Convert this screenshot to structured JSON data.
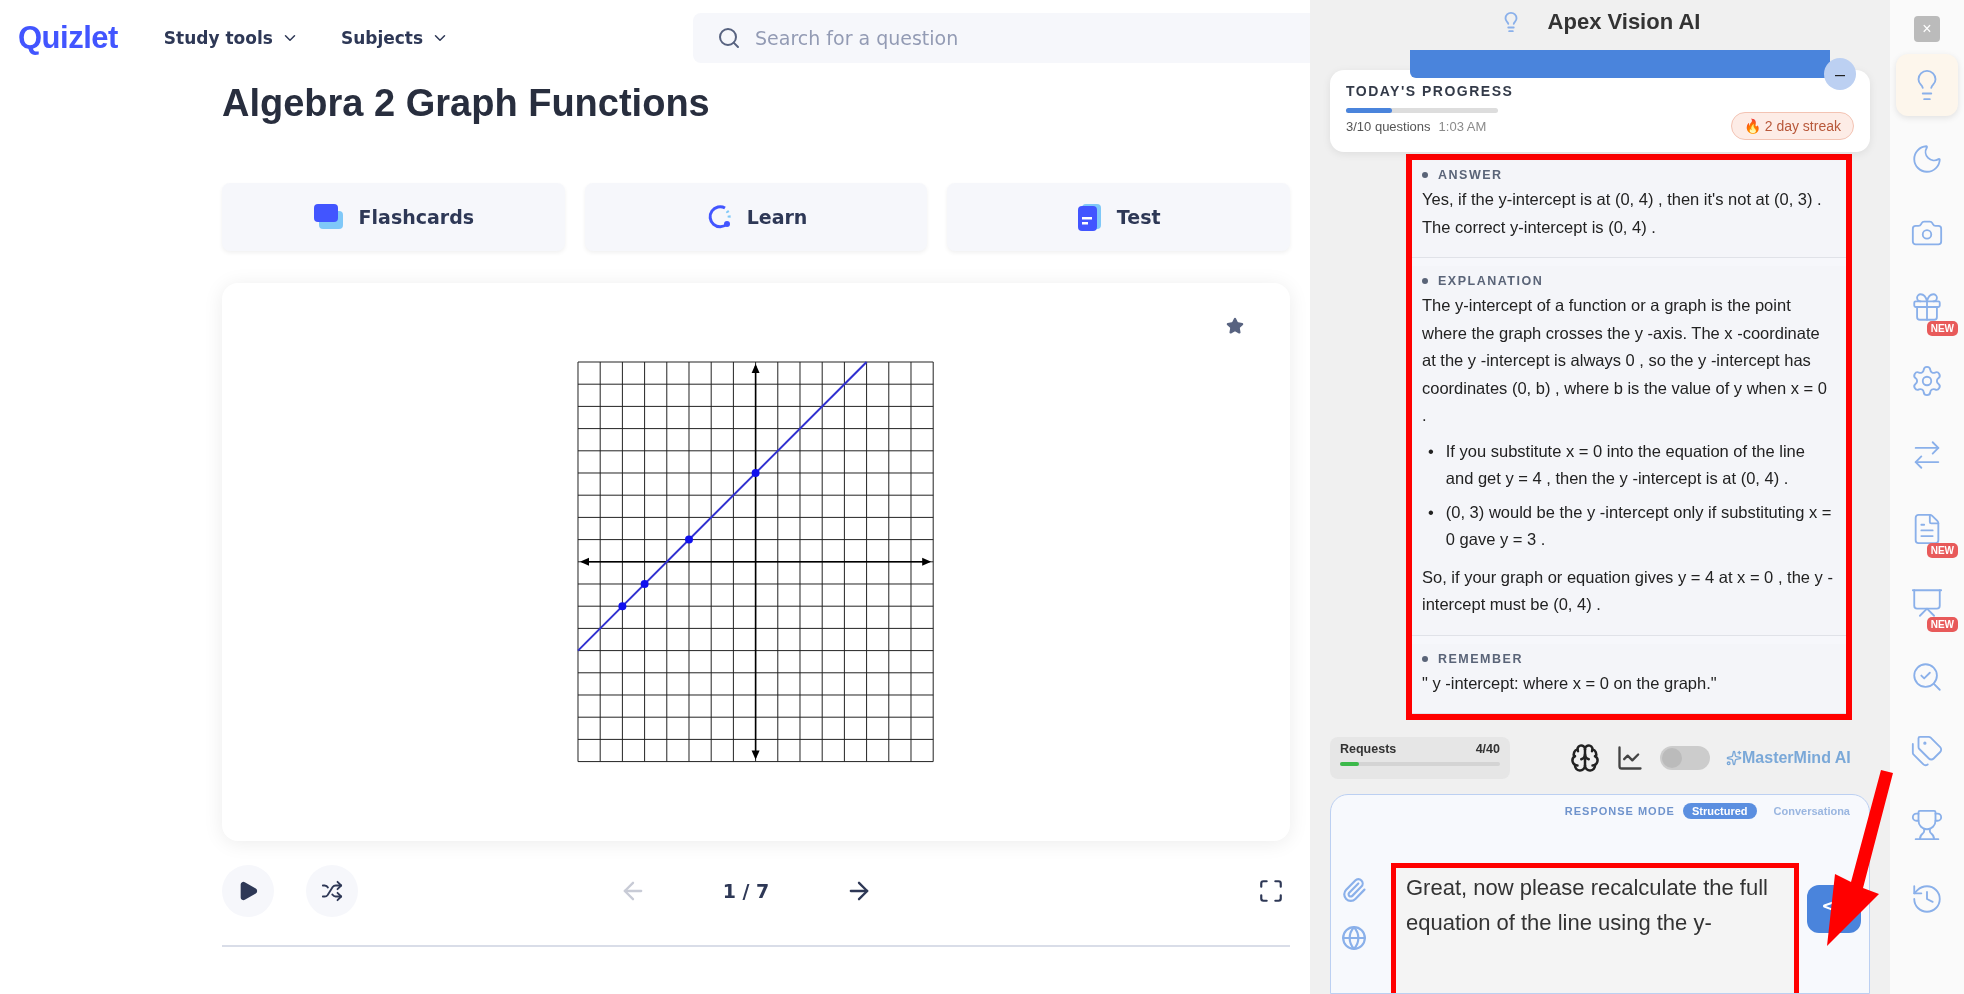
{
  "header": {
    "logo": "Quizlet",
    "nav": [
      {
        "label": "Study tools"
      },
      {
        "label": "Subjects"
      }
    ],
    "search": {
      "placeholder": "Search for a question"
    }
  },
  "set": {
    "title": "Algebra 2 Graph Functions",
    "modes": [
      {
        "kind": "flashcards",
        "label": "Flashcards"
      },
      {
        "kind": "learn",
        "label": "Learn"
      },
      {
        "kind": "test",
        "label": "Test"
      }
    ]
  },
  "controls": {
    "counter": "1 / 7",
    "prev_disabled": true
  },
  "assistant": {
    "title": "Apex Vision AI",
    "progress": {
      "heading": "TODAY'S PROGRESS",
      "level": 0.3,
      "count": "3/10 questions",
      "time": "1:03 AM",
      "streak": "🔥 2 day streak",
      "minimize": "–"
    },
    "sections": [
      {
        "heading": "ANSWER",
        "blocks": [
          {
            "kind": "paragraph",
            "text": "Yes, if the y-intercept is at (0, 4) , then it's not at (0, 3) . The correct y-intercept is (0, 4) ."
          }
        ]
      },
      {
        "heading": "EXPLANATION",
        "blocks": [
          {
            "kind": "paragraph",
            "text": "The y-intercept of a function or a graph is the point where the graph crosses the y -axis. The x -coordinate at the y -intercept is always 0 , so the y -intercept has coordinates (0, b) , where b is the value of y when x = 0 ."
          },
          {
            "kind": "bullets",
            "marker": "•",
            "items": [
              "If you substitute x = 0 into the equation of the line and get y = 4 , then the y -intercept is at (0, 4) .",
              "(0, 3) would be the y -intercept only if substituting x = 0 gave y = 3 ."
            ]
          },
          {
            "kind": "paragraph",
            "text": "So, if your graph or equation gives y = 4 at x = 0 , the y -intercept must be (0, 4) ."
          }
        ]
      },
      {
        "heading": "REMEMBER",
        "blocks": [
          {
            "kind": "paragraph",
            "text": "\" y -intercept: where x = 0 on the graph.\""
          }
        ]
      }
    ],
    "requests": {
      "label": "Requests",
      "count": "4/40",
      "level": 0.12
    },
    "mastermind": {
      "on": false,
      "label": "MasterMind AI"
    },
    "response_mode": {
      "label": "RESPONSE MODE",
      "options": [
        {
          "label": "Structured",
          "selected": true
        },
        {
          "label": "Conversationa",
          "selected": false
        }
      ]
    },
    "message": {
      "value": "Great, now please recalculate the full equation of the line using the y-"
    }
  },
  "toolbar": {
    "close": "×",
    "items": [
      {
        "kind": "assistant",
        "selected": true
      },
      {
        "kind": "night",
        "selected": false
      },
      {
        "kind": "screenshot",
        "selected": false
      },
      {
        "kind": "gift",
        "selected": false,
        "badge": "NEW"
      },
      {
        "kind": "settings",
        "selected": false
      },
      {
        "kind": "tabs",
        "selected": false
      },
      {
        "kind": "grade",
        "selected": false,
        "badge": "NEW"
      },
      {
        "kind": "teacher",
        "selected": false,
        "badge": "NEW"
      },
      {
        "kind": "inspect",
        "selected": false
      },
      {
        "kind": "pricing",
        "selected": false
      },
      {
        "kind": "ranking",
        "selected": false
      },
      {
        "kind": "history",
        "selected": false
      }
    ]
  }
}
